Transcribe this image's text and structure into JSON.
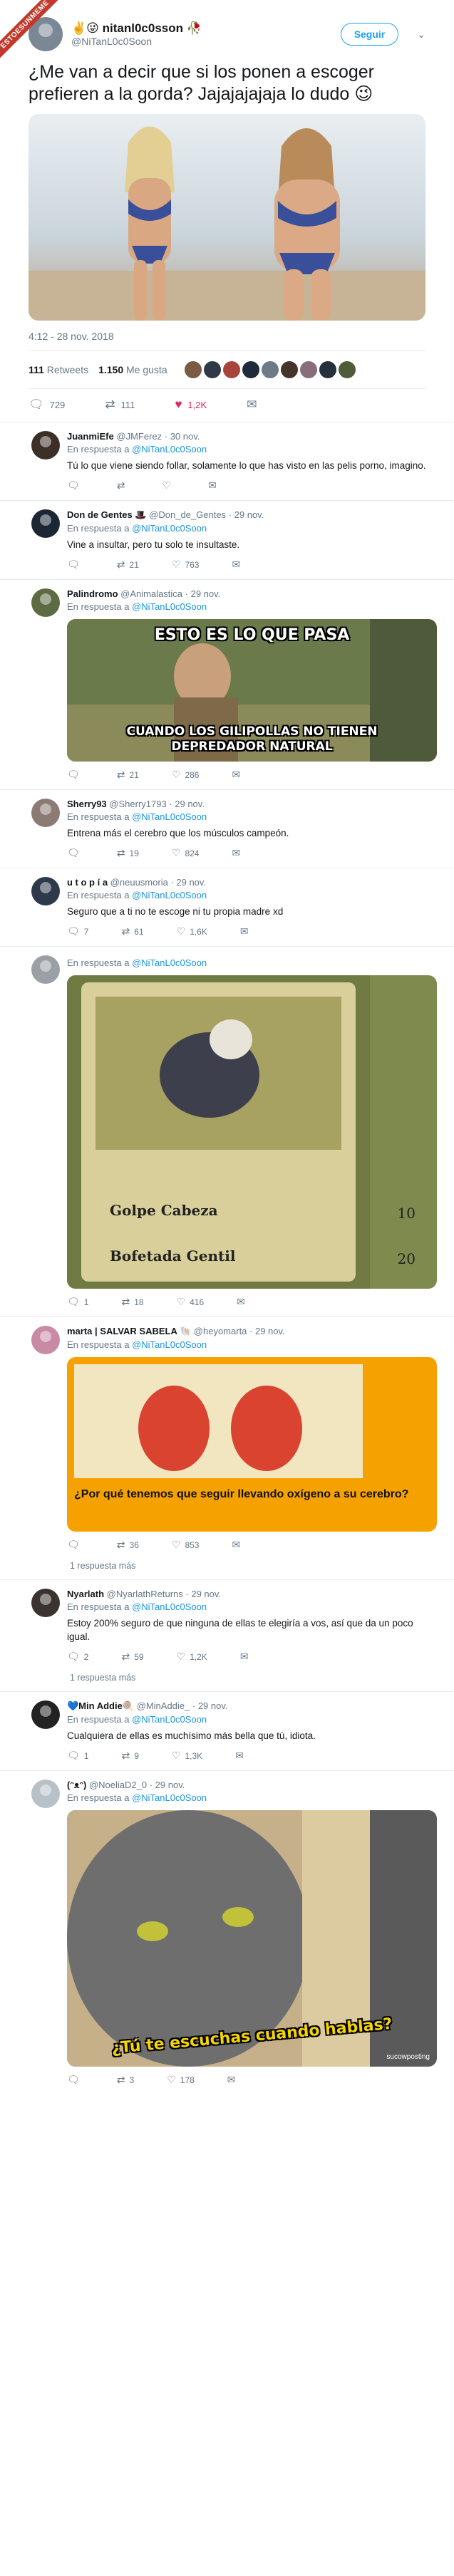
{
  "badge": "ESTOESUNMEME",
  "tweet": {
    "name": "nitanl0c0sson",
    "emojis": "✌️😜",
    "rose": "🥀",
    "handle": "@NiTanL0c0Soon",
    "follow": "Seguir",
    "chevron": "⌄",
    "text": "¿Me van a decir que si los ponen a escoger prefieren a la gorda? Jajajajajaja lo dudo 😉",
    "time": "4:12 - 28 nov. 2018",
    "retweets_count": "111",
    "retweets_label": "Retweets",
    "likes_count": "1.150",
    "likes_label": "Me gusta",
    "actions": {
      "reply": "729",
      "retweet": "111",
      "like": "1,2K"
    }
  },
  "replies": [
    {
      "name": "JuanmiEfe",
      "handle": "@JMFerez",
      "date": "· 30 nov.",
      "in_reply": "En respuesta a",
      "to": "@NiTanL0c0Soon",
      "text": "Tú lo que viene siendo follar, solamente lo que has visto en las pelis porno, imagino.",
      "reply": "",
      "rt": "",
      "like": ""
    },
    {
      "name": "Don de Gentes 🎩",
      "handle": "@Don_de_Gentes",
      "date": "· 29 nov.",
      "in_reply": "En respuesta a",
      "to": "@NiTanL0c0Soon",
      "text": "Vine a insultar, pero tu solo te insultaste.",
      "reply": "",
      "rt": "21",
      "like": "763"
    },
    {
      "name": "Palindromo",
      "handle": "@Animalastica",
      "date": "· 29 nov.",
      "in_reply": "En respuesta a",
      "to": "@NiTanL0c0Soon",
      "text": "",
      "reply": "",
      "rt": "21",
      "like": "286",
      "meme_top": "ESTO ES LO QUE PASA",
      "meme_bottom": "CUANDO LOS GILIPOLLAS NO TIENEN DEPREDADOR NATURAL"
    },
    {
      "name": "Sherry93",
      "handle": "@Sherry1793",
      "date": "· 29 nov.",
      "in_reply": "En respuesta a",
      "to": "@NiTanL0c0Soon",
      "text": "Entrena más el cerebro que los músculos campeón.",
      "reply": "",
      "rt": "19",
      "like": "824"
    },
    {
      "name": "u t o p í a",
      "handle": "@neuusmoria",
      "date": "· 29 nov.",
      "in_reply": "En respuesta a",
      "to": "@NiTanL0c0Soon",
      "text": "Seguro que a ti no te escoge ni tu propia madre xd",
      "reply": "7",
      "rt": "61",
      "like": "1,6K"
    },
    {
      "name": "",
      "handle": "",
      "date": "",
      "in_reply": "En respuesta a",
      "to": "@NiTanL0c0Soon",
      "text": "",
      "reply": "1",
      "rt": "18",
      "like": "416",
      "card_move1": "Golpe Cabeza",
      "card_dmg1": "10",
      "card_move2": "Bofetada Gentil",
      "card_dmg2": "20"
    },
    {
      "name": "marta | SALVAR SABELA 🐚",
      "handle": "@heyomarta",
      "date": "· 29 nov.",
      "in_reply": "En respuesta a",
      "to": "@NiTanL0c0Soon",
      "text": "",
      "reply": "",
      "rt": "36",
      "like": "853",
      "meme_text": "¿Por qué tenemos que seguir llevando oxígeno a su cerebro?",
      "more": "1 respuesta más"
    },
    {
      "name": "Nyarlath",
      "handle": "@NyarlathReturns",
      "date": "· 29 nov.",
      "in_reply": "En respuesta a",
      "to": "@NiTanL0c0Soon",
      "text": "Estoy 200% seguro de que ninguna de ellas te elegiría a vos, así que da un poco igual.",
      "reply": "2",
      "rt": "59",
      "like": "1,2K",
      "more": "1 respuesta más"
    },
    {
      "name": "💙Min Addie🍭",
      "handle": "@MinAddie_",
      "date": "· 29 nov.",
      "in_reply": "En respuesta a",
      "to": "@NiTanL0c0Soon",
      "text": "Cualquiera de ellas es muchísimo más bella que tú, idiota.",
      "reply": "1",
      "rt": "9",
      "like": "1,3K"
    },
    {
      "name": "(ᵔᴥᵔ)",
      "handle": "@NoeliaD2_0",
      "date": "· 29 nov.",
      "in_reply": "En respuesta a",
      "to": "@NiTanL0c0Soon",
      "text": "",
      "reply": "",
      "rt": "3",
      "like": "178",
      "meme_text": "¿Tú te escuchas cuando hablas?",
      "watermark": "sucowposting"
    }
  ],
  "icons": {
    "reply": "🗨",
    "retweet": "⇄",
    "like": "♡",
    "liked": "♥",
    "dm": "✉"
  }
}
